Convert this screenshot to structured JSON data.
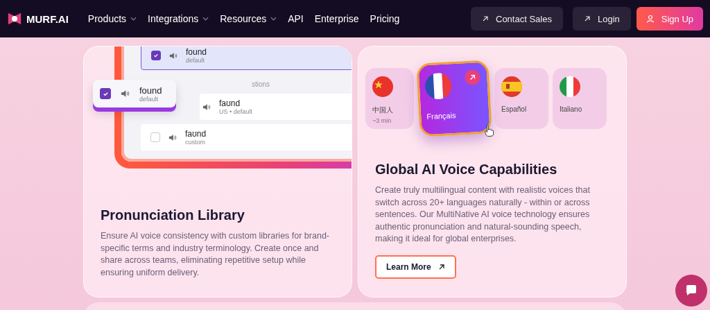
{
  "nav": {
    "logo": "MURF.AI",
    "links": [
      {
        "label": "Products",
        "dropdown": true
      },
      {
        "label": "Integrations",
        "dropdown": true
      },
      {
        "label": "Resources",
        "dropdown": true
      },
      {
        "label": "API",
        "dropdown": false
      },
      {
        "label": "Enterprise",
        "dropdown": false
      },
      {
        "label": "Pricing",
        "dropdown": false
      }
    ],
    "actions": [
      {
        "label": "Contact Sales",
        "kind": "arrow"
      },
      {
        "label": "Login",
        "kind": "arrow"
      },
      {
        "label": "Sign Up",
        "kind": "user"
      }
    ]
  },
  "pronunciation_card": {
    "illustration": {
      "rows": [
        {
          "word": "found",
          "meta": "default",
          "checked": true,
          "selected": true
        },
        {
          "word": "faʊnd",
          "meta": "US • default",
          "selected": false
        },
        {
          "word": "faʊnd",
          "meta": "custom",
          "checked": false,
          "selected": false
        }
      ],
      "section_label": "stions",
      "floating_row": {
        "word": "found",
        "meta": "default",
        "checked": true
      }
    },
    "title": "Pronunciation Library",
    "body": "Ensure AI voice consistency with custom libraries for brand-specific terms and industry terminology. Create once and share across teams, eliminating repetitive setup while ensuring uniform delivery."
  },
  "voice_card": {
    "languages": [
      {
        "name": "中国人",
        "meta": "~3 min",
        "kind": "china",
        "selected": false
      },
      {
        "name": "Français",
        "kind": "france",
        "selected": true
      },
      {
        "name": "Español",
        "kind": "spain",
        "selected": false
      },
      {
        "name": "Italiano",
        "kind": "italy",
        "selected": false
      }
    ],
    "title": "Global AI Voice Capabilities",
    "body": "Create truly multilingual content with realistic voices that switch across 20+ languages naturally - within or across sentences. Our MultiNative AI voice technology ensures authentic pronunciation and natural-sounding speech, making it ideal for global enterprises.",
    "button": "Learn More"
  }
}
